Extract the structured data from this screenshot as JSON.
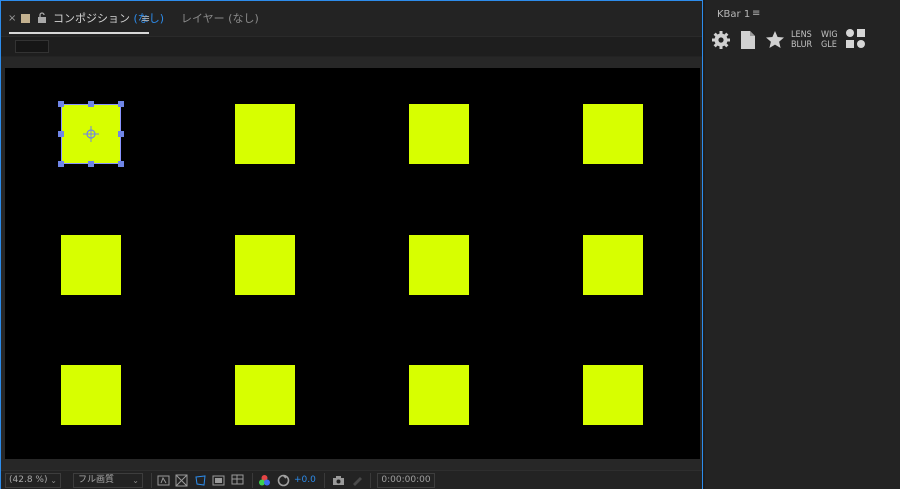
{
  "comp_panel": {
    "tab": {
      "close": "×",
      "menu": "≡",
      "comp_label_prefix": "コンポジション ",
      "comp_label_paren": "(なし)",
      "layer_label": "レイヤー (なし)"
    },
    "footer": {
      "zoom": "(42.8 %)",
      "quality": "フル画質",
      "exposure": "+0.0",
      "timecode": "0:00:00:00"
    }
  },
  "kbar": {
    "title": "KBar 1",
    "menu": "≡",
    "buttons": [
      {
        "name": "gear-icon"
      },
      {
        "name": "document-icon"
      },
      {
        "name": "star-icon"
      }
    ],
    "text_buttons": [
      {
        "line1": "LENS",
        "line2": "BLUR"
      },
      {
        "line1": "WIG",
        "line2": "GLE"
      }
    ]
  },
  "colors": {
    "accent": "#2d8ceb",
    "square": "#d7ff00",
    "selection": "#6f85e6"
  }
}
